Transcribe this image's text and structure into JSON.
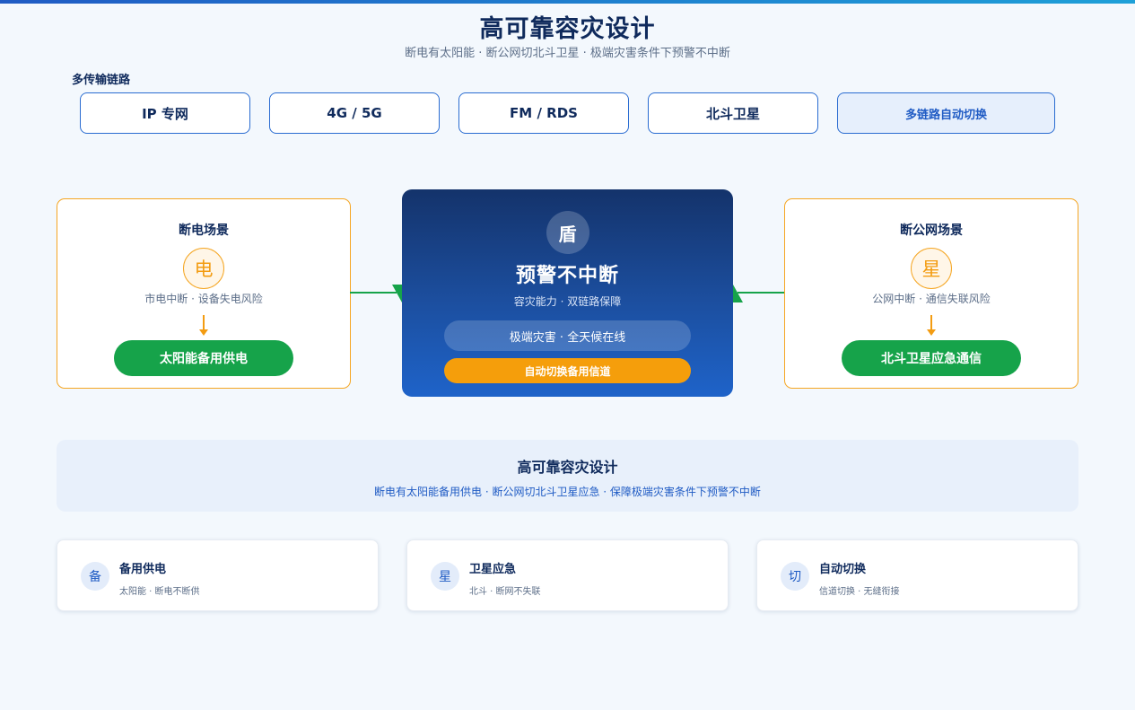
{
  "header": {
    "title": "高可靠容灾设计",
    "subtitle": "断电有太阳能 · 断公网切北斗卫星 · 极端灾害条件下预警不中断"
  },
  "links": {
    "label": "多传输链路",
    "items": [
      "IP 专网",
      "4G / 5G",
      "FM / RDS",
      "北斗卫星"
    ],
    "auto": "多链路自动切换"
  },
  "left_scene": {
    "title": "断电场景",
    "icon": "电",
    "desc": "市电中断 · 设备失电风险",
    "action": "太阳能备用供电"
  },
  "center": {
    "icon": "盾",
    "title": "预警不中断",
    "sub": "容灾能力 · 双链路保障",
    "pill1": "极端灾害 · 全天候在线",
    "pill2": "自动切换备用信道"
  },
  "right_scene": {
    "title": "断公网场景",
    "icon": "星",
    "desc": "公网中断 · 通信失联风险",
    "action": "北斗卫星应急通信"
  },
  "banner": {
    "title": "高可靠容灾设计",
    "sub": "断电有太阳能备用供电 · 断公网切北斗卫星应急 · 保障极端灾害条件下预警不中断"
  },
  "features": [
    {
      "icon": "备",
      "title": "备用供电",
      "desc": "太阳能 · 断电不断供"
    },
    {
      "icon": "星",
      "title": "卫星应急",
      "desc": "北斗 · 断网不失联"
    },
    {
      "icon": "切",
      "title": "自动切换",
      "desc": "信道切换 · 无缝衔接"
    }
  ],
  "colors": {
    "primary": "#0f2a5c",
    "accent": "#1f5bc4",
    "warning": "#f5a623",
    "success": "#16a34a"
  }
}
